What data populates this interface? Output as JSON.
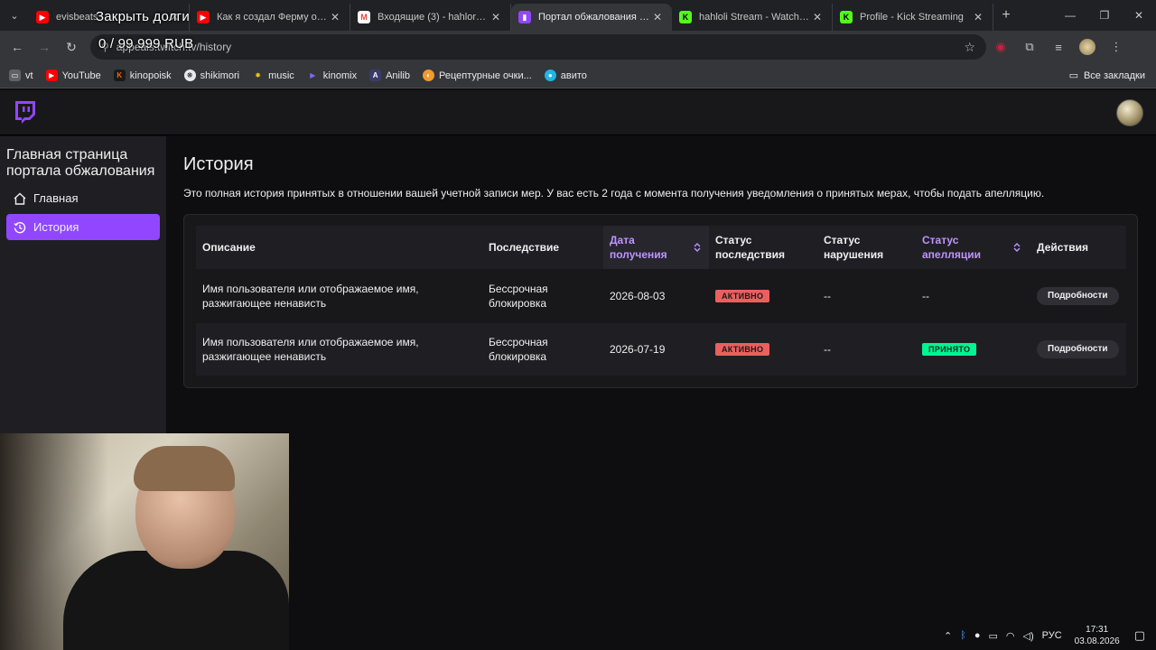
{
  "browser": {
    "tabs": [
      {
        "title": "evisbeats",
        "color": "#ff0000",
        "icon": "youtube-icon"
      },
      {
        "title": "Как я создал Ферму офлайн",
        "color": "#ff0000",
        "icon": "youtube-icon"
      },
      {
        "title": "Входящие (3) - hahloraine",
        "color": "#ea4335",
        "icon": "gmail-icon"
      },
      {
        "title": "Портал обжалования - Tw",
        "color": "#9147ff",
        "icon": "twitch-icon"
      },
      {
        "title": "hahloli Stream - Watch Live",
        "color": "#53fc18",
        "icon": "kick-icon"
      },
      {
        "title": "Profile - Kick Streaming",
        "color": "#53fc18",
        "icon": "kick-icon"
      }
    ],
    "url": "appeals.twitch.tv/history",
    "bookmarks": [
      {
        "label": "vt",
        "color": "#e8eaed",
        "icon": "folder-icon"
      },
      {
        "label": "YouTube",
        "color": "#ff0000",
        "icon": "youtube-icon"
      },
      {
        "label": "kinopoisk",
        "color": "#ff6600",
        "icon": "kinopoisk-icon"
      },
      {
        "label": "shikimori",
        "color": "#e8eaed",
        "icon": "shikimori-icon"
      },
      {
        "label": "music",
        "color": "#f2c200",
        "icon": "music-icon"
      },
      {
        "label": "kinomix",
        "color": "#7c6cf0",
        "icon": "play-icon"
      },
      {
        "label": "Anilib",
        "color": "#3b3b6b",
        "icon": "anilib-icon"
      },
      {
        "label": "Рецептурные очки...",
        "color": "#f29a2e",
        "icon": "glasses-icon"
      },
      {
        "label": "авито",
        "color": "#1fb5e8",
        "icon": "avito-icon"
      }
    ],
    "all_bookmarks": "Все закладки"
  },
  "overlay": {
    "line1": "Закрыть долги",
    "line2": "0 / 99 999 RUB"
  },
  "sidebar": {
    "title": "Главная страница портала обжалования",
    "items": [
      {
        "label": "Главная",
        "icon": "home-icon"
      },
      {
        "label": "История",
        "icon": "history-icon"
      }
    ]
  },
  "main": {
    "title": "История",
    "description": "Это полная история принятых в отношении вашей учетной записи мер. У вас есть 2 года с момента получения уведомления о принятых мерах, чтобы подать апелляцию.",
    "columns": {
      "description": "Описание",
      "consequence": "Последствие",
      "received": "Дата получения",
      "consequence_status": "Статус последствия",
      "violation_status": "Статус нарушения",
      "appeal_status": "Статус апелляции",
      "actions": "Действия"
    },
    "rows": [
      {
        "description": "Имя пользователя или отображаемое имя, разжигающее ненависть",
        "consequence": "Бессрочная блокировка",
        "received": "2026-08-03",
        "consequence_status": "АКТИВНО",
        "violation_status": "--",
        "appeal_status": "--",
        "action": "Подробности"
      },
      {
        "description": "Имя пользователя или отображаемое имя, разжигающее ненависть",
        "consequence": "Бессрочная блокировка",
        "received": "2026-07-19",
        "consequence_status": "АКТИВНО",
        "violation_status": "--",
        "appeal_status": "ПРИНЯТО",
        "action": "Подробности"
      }
    ],
    "colors": {
      "accent": "#9147ff",
      "active_badge": "#eb5f5f",
      "accepted_badge": "#00f593",
      "sort_header": "#bf94ff"
    }
  },
  "taskbar": {
    "language": "РУС",
    "time": "17:31",
    "date": "03.08.2026"
  }
}
